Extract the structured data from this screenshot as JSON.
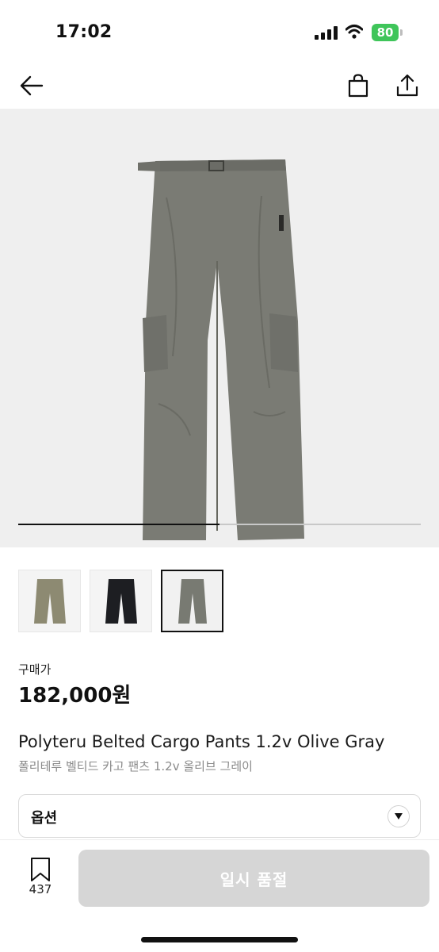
{
  "status_bar": {
    "time": "17:02",
    "battery": "80",
    "battery_color": "#3fc55a"
  },
  "nav": {
    "back_icon": "arrow-left-icon",
    "cart_icon": "shopping-bag-icon",
    "share_icon": "share-icon"
  },
  "gallery": {
    "image_color": "#7a7b74",
    "background": "#efefef",
    "progress": 0.5,
    "thumbnails": [
      {
        "color": "#8d8a72",
        "selected": false
      },
      {
        "color": "#1d1e22",
        "selected": false
      },
      {
        "color": "#787a72",
        "selected": true
      }
    ]
  },
  "price": {
    "label": "구매가",
    "value": "182,000원"
  },
  "product": {
    "name_en": "Polyteru Belted Cargo Pants 1.2v Olive Gray",
    "name_ko": "폴리테루 벨티드 카고 팬츠 1.2v 올리브 그레이"
  },
  "option": {
    "label": "옵션",
    "icon": "chevron-down-icon"
  },
  "bottom_bar": {
    "bookmark_icon": "bookmark-icon",
    "bookmark_count": "437",
    "cta_label": "일시 품절",
    "cta_color": "#d6d6d6"
  }
}
